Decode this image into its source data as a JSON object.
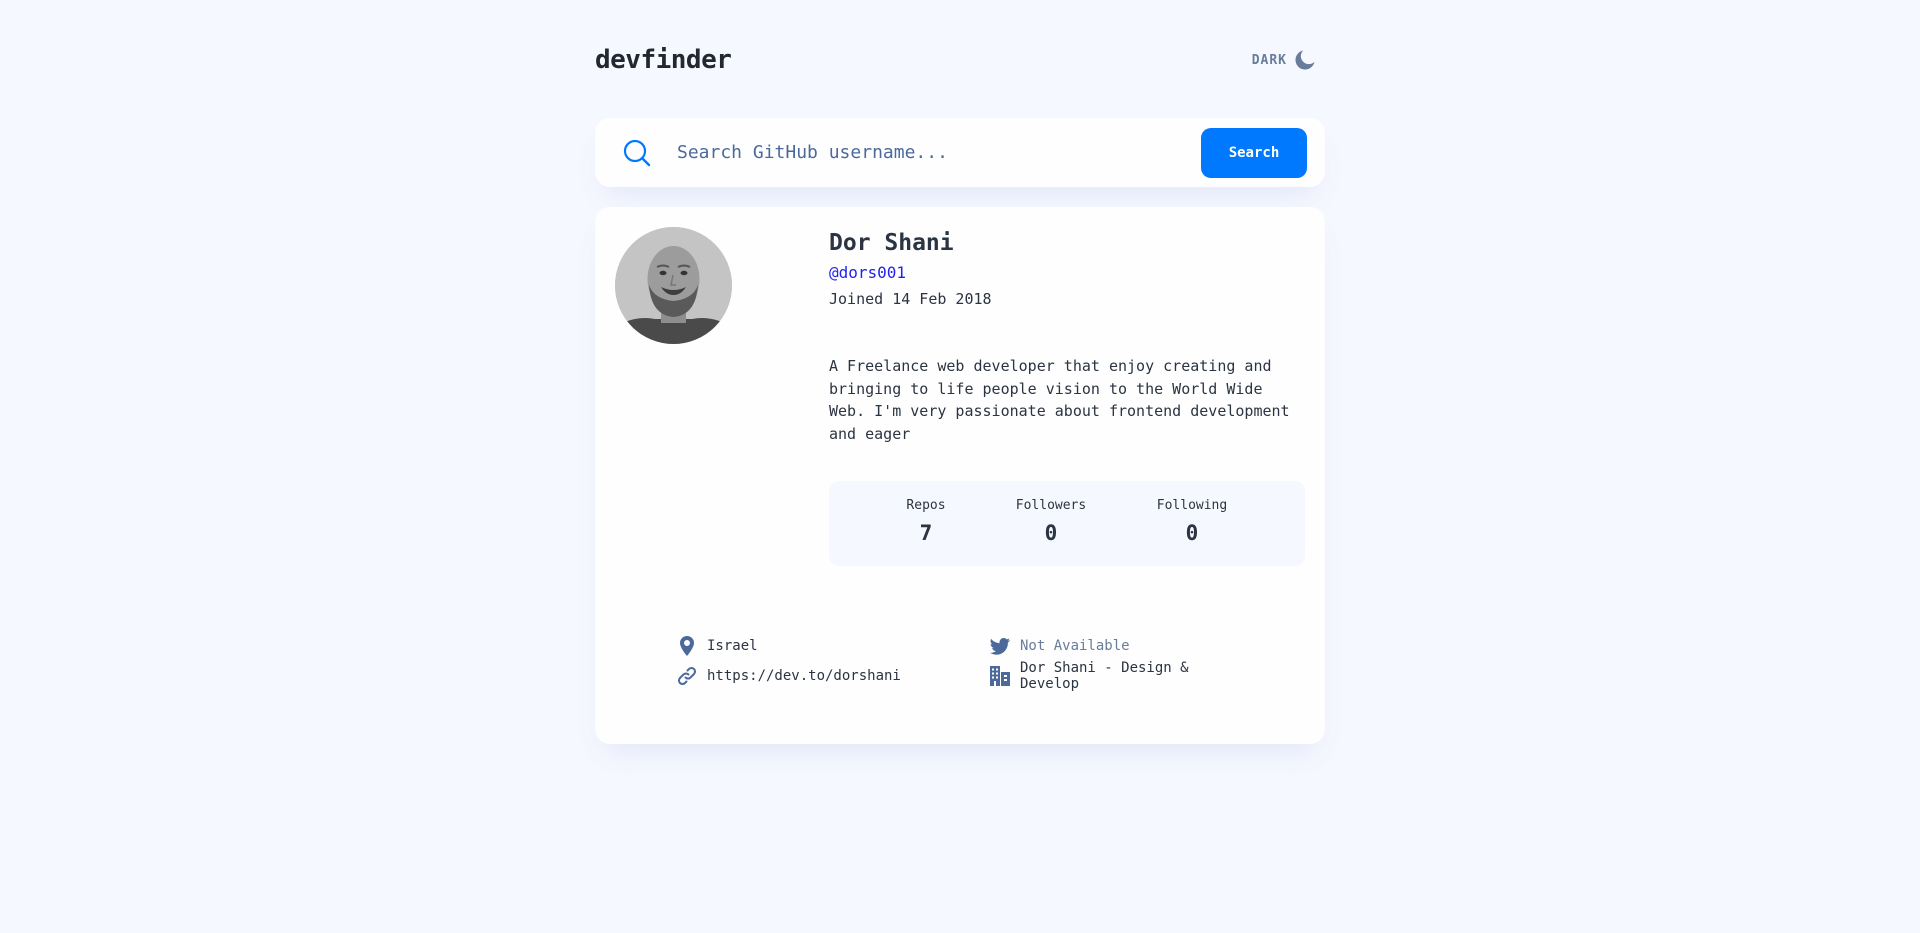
{
  "header": {
    "logo": "devfinder",
    "theme_toggle_label": "DARK",
    "theme_icon": "moon-icon"
  },
  "search": {
    "icon": "search-icon",
    "placeholder": "Search GitHub username...",
    "value": "",
    "button_label": "Search"
  },
  "profile": {
    "avatar": "avatar-photo",
    "name": "Dor Shani",
    "login": "@dors001",
    "joined": "Joined 14 Feb 2018",
    "bio": "A Freelance web developer that enjoy creating and bringing to life people vision to the World Wide Web. I'm very passionate about frontend development and eager",
    "stats": {
      "repos_label": "Repos",
      "repos": "7",
      "followers_label": "Followers",
      "followers": "0",
      "following_label": "Following",
      "following": "0"
    },
    "links": {
      "location": "Israel",
      "blog": "https://dev.to/dorshani",
      "twitter": "Not Available",
      "company": "Dor Shani - Design & Develop"
    }
  },
  "colors": {
    "background": "#F6F8FF",
    "card": "#FEFEFE",
    "accent": "#0079FF",
    "text": "#2B3442",
    "muted": "#697C9A",
    "login_link": "#2222EE"
  }
}
